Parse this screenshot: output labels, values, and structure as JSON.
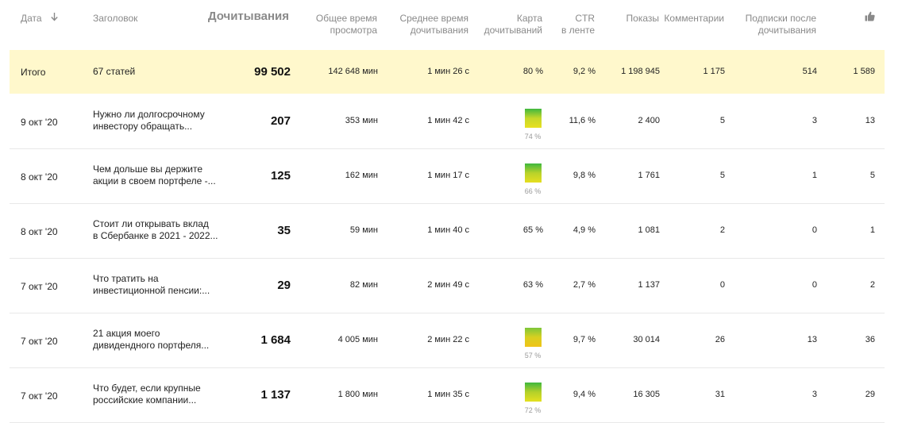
{
  "headers": {
    "date": "Дата",
    "title": "Заголовок",
    "reads": "Дочитывания",
    "total_time": [
      "Общее время",
      "просмотра"
    ],
    "avg_time": [
      "Среднее время",
      "дочитывания"
    ],
    "read_map": [
      "Карта",
      "дочитываний"
    ],
    "ctr": [
      "CTR",
      "в ленте"
    ],
    "impressions": "Показы",
    "comments": "Комментарии",
    "subs": [
      "Подписки после",
      "дочитывания"
    ],
    "likes_icon": "thumbs-up-icon",
    "sort_icon": "arrow-down-icon"
  },
  "total": {
    "label": "Итого",
    "title": "67 статей",
    "reads": "99 502",
    "total_time": "142 648 мин",
    "avg_time": "1 мин 26 с",
    "read_map": "80 %",
    "ctr": "9,2 %",
    "impressions": "1 198 945",
    "comments": "1 175",
    "subs": "514",
    "likes": "1 589"
  },
  "rows": [
    {
      "date": "9 окт '20",
      "title1": "Нужно ли долгосрочному",
      "title2": "инвестору обращать...",
      "reads": "207",
      "total_time": "353 мин",
      "avg_time": "1 мин 42 с",
      "map_pct": "74 %",
      "ctr": "11,6 %",
      "impressions": "2 400",
      "comments": "5",
      "subs": "3",
      "likes": "13"
    },
    {
      "date": "8 окт '20",
      "title1": "Чем дольше вы держите",
      "title2": "акции в своем портфеле -...",
      "reads": "125",
      "total_time": "162 мин",
      "avg_time": "1 мин 17 с",
      "map_pct": "66 %",
      "ctr": "9,8 %",
      "impressions": "1 761",
      "comments": "5",
      "subs": "1",
      "likes": "5"
    },
    {
      "date": "8 окт '20",
      "title1": "Стоит ли открывать вклад",
      "title2": "в Сбербанке в 2021 - 2022...",
      "reads": "35",
      "total_time": "59 мин",
      "avg_time": "1 мин 40 с",
      "map_pct": "65 %",
      "ctr": "4,9 %",
      "impressions": "1 081",
      "comments": "2",
      "subs": "0",
      "likes": "1"
    },
    {
      "date": "7 окт '20",
      "title1": "Что тратить на",
      "title2": "инвестиционной пенсии:...",
      "reads": "29",
      "total_time": "82 мин",
      "avg_time": "2 мин 49 с",
      "map_pct": "63 %",
      "ctr": "2,7 %",
      "impressions": "1 137",
      "comments": "0",
      "subs": "0",
      "likes": "2"
    },
    {
      "date": "7 окт '20",
      "title1": "21 акция моего",
      "title2": "дивидендного портфеля...",
      "reads": "1 684",
      "total_time": "4 005 мин",
      "avg_time": "2 мин 22 с",
      "map_pct": "57 %",
      "ctr": "9,7 %",
      "impressions": "30 014",
      "comments": "26",
      "subs": "13",
      "likes": "36"
    },
    {
      "date": "7 окт '20",
      "title1": "Что будет, если крупные",
      "title2": "российские компании...",
      "reads": "1 137",
      "total_time": "1 800 мин",
      "avg_time": "1 мин 35 с",
      "map_pct": "72 %",
      "ctr": "9,4 %",
      "impressions": "16 305",
      "comments": "31",
      "subs": "3",
      "likes": "29"
    }
  ],
  "gauges": [
    {
      "level": 0.74,
      "colors": [
        "#3fb83f",
        "#c6d82a",
        "#e8e020"
      ]
    },
    {
      "level": 0.66,
      "colors": [
        "#3fb83f",
        "#b8d22a",
        "#e6de20"
      ]
    },
    null,
    null,
    {
      "level": 0.57,
      "colors": [
        "#7dc63a",
        "#d8d020",
        "#f0c418"
      ]
    },
    {
      "level": 0.72,
      "colors": [
        "#3fb83f",
        "#b4d02a",
        "#e4e020"
      ]
    }
  ]
}
